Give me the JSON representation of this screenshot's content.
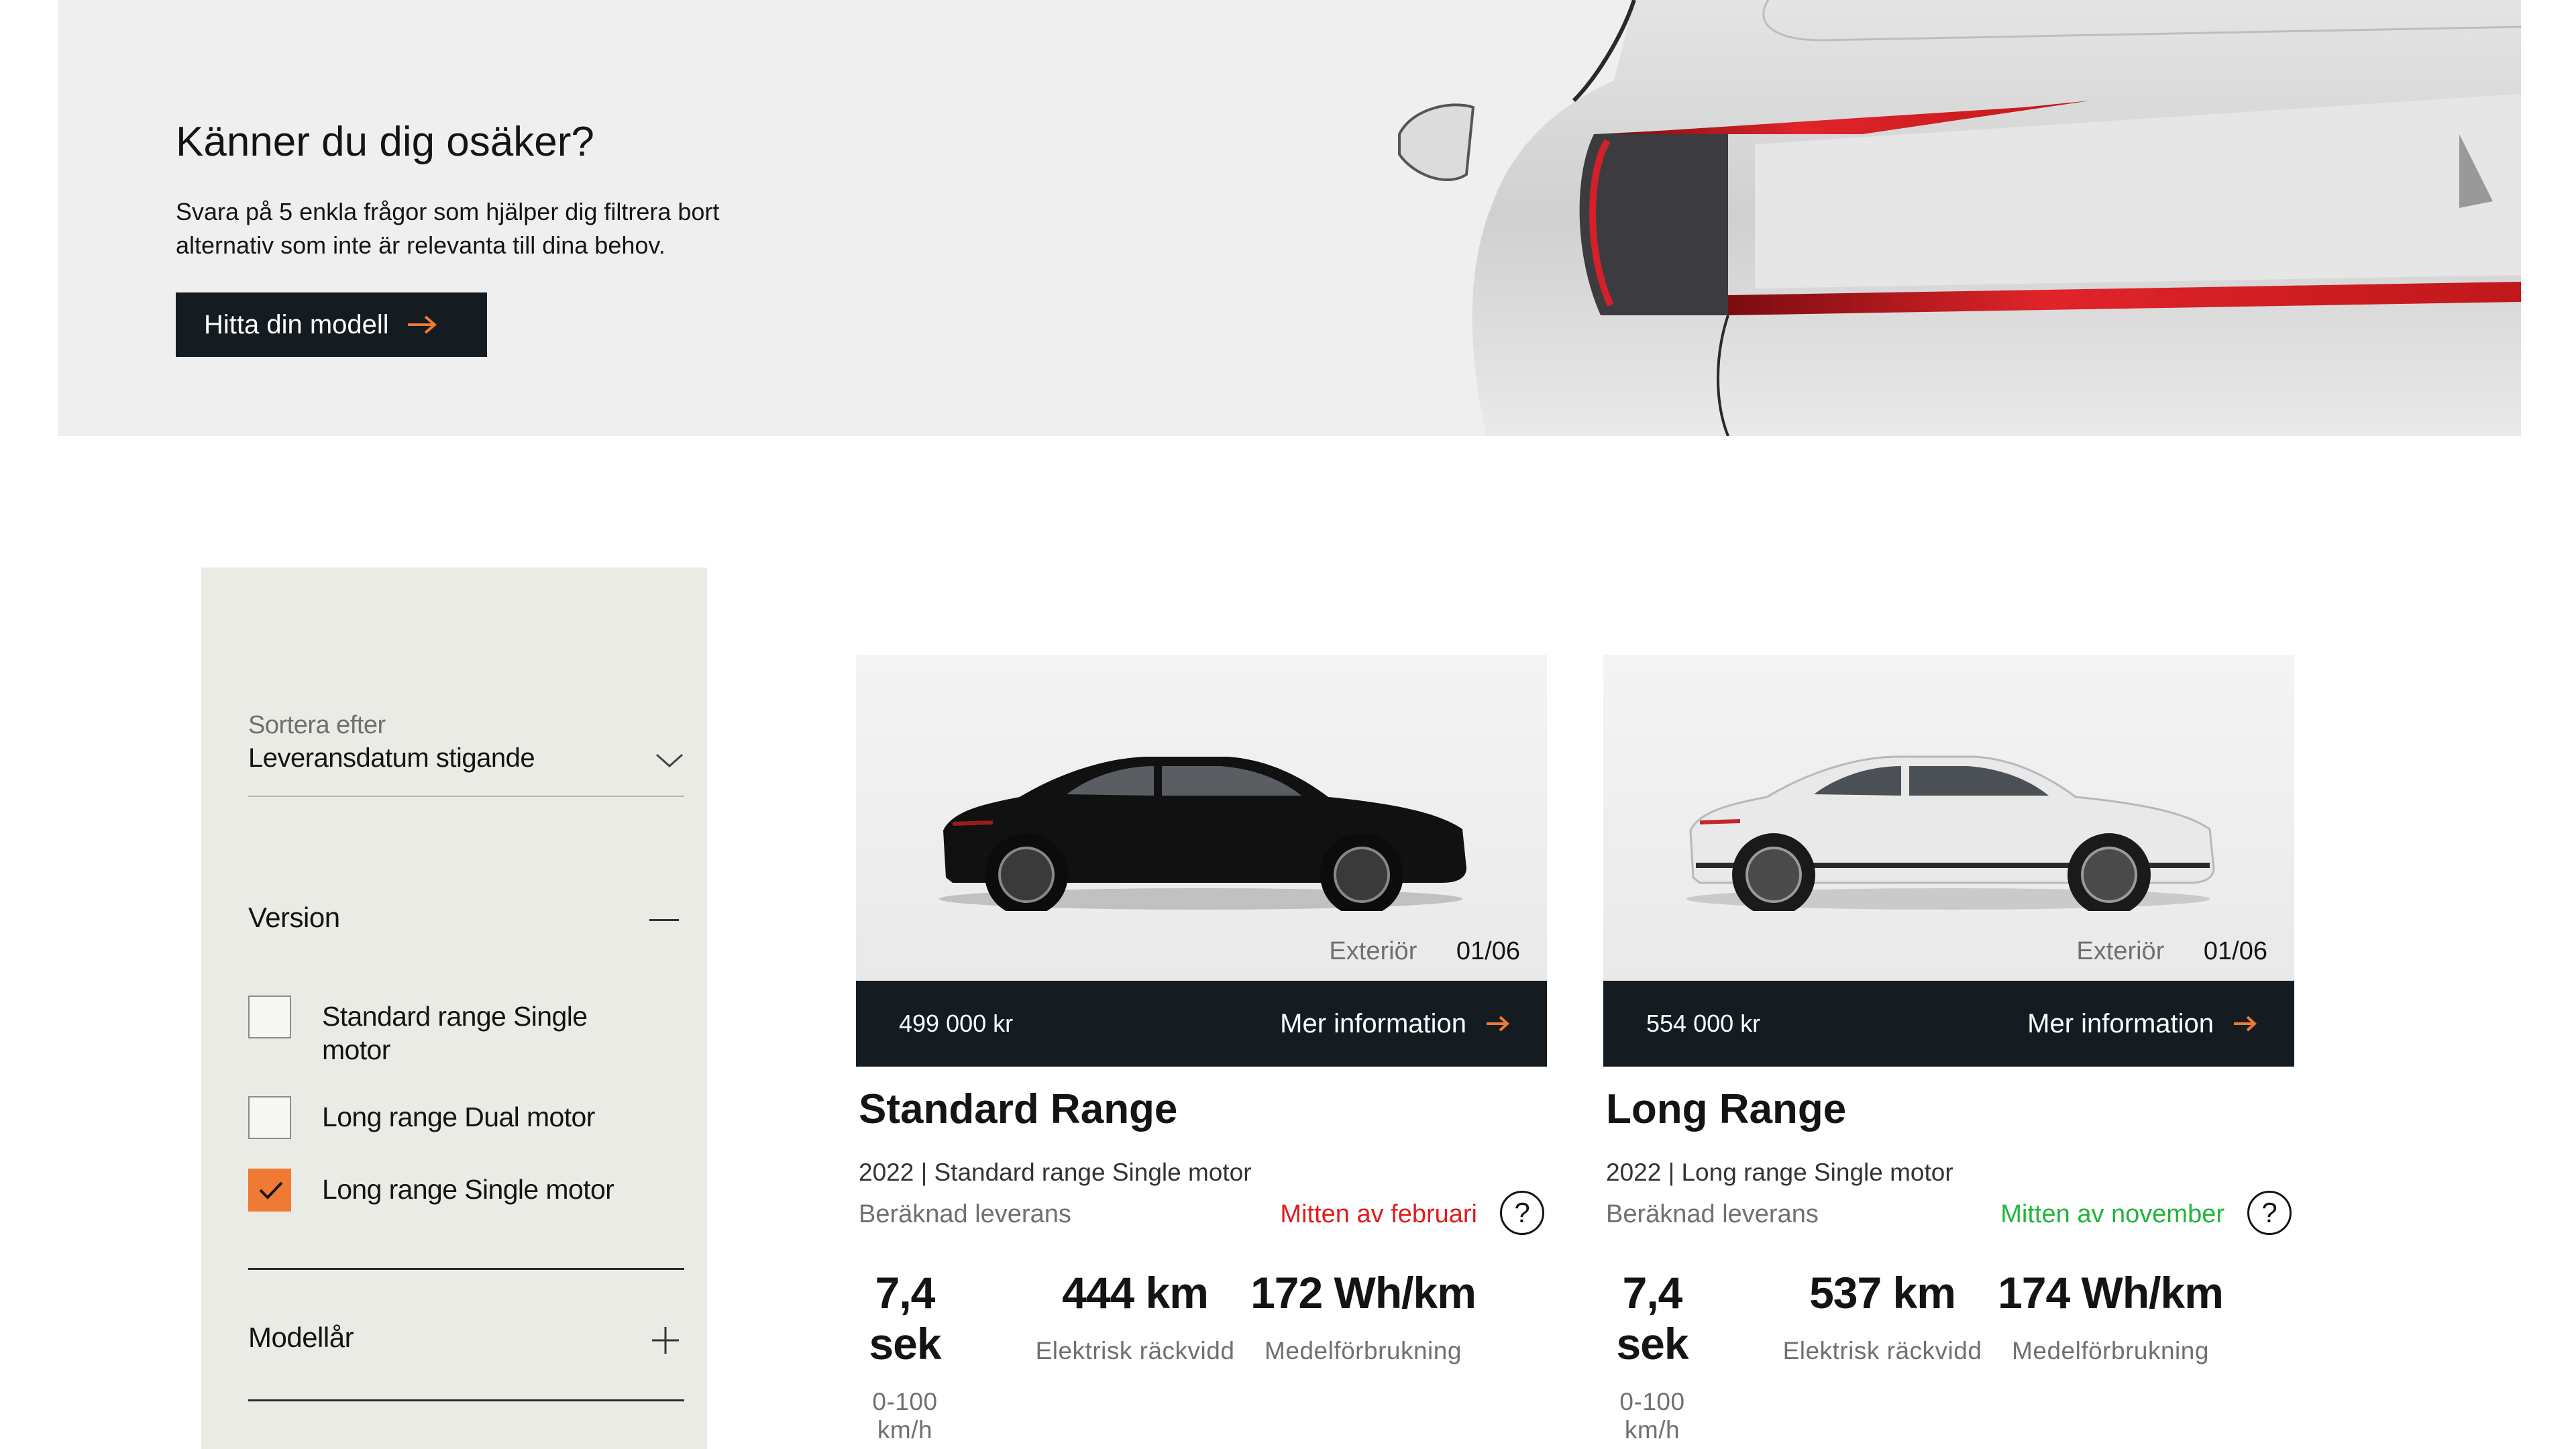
{
  "hero": {
    "title": "Känner du dig osäker?",
    "subtitle": "Svara på 5 enkla frågor som hjälper dig filtrera bort alternativ som inte är relevanta till dina behov.",
    "button_label": "Hitta din modell"
  },
  "filters": {
    "sort_label": "Sortera efter",
    "sort_value": "Leveransdatum stigande",
    "version_title": "Version",
    "options": [
      {
        "label": "Standard range Single motor",
        "checked": false
      },
      {
        "label": "Long range Dual motor",
        "checked": false
      },
      {
        "label": "Long range Single motor",
        "checked": true
      }
    ],
    "model_year_title": "Modellår"
  },
  "cards": [
    {
      "image_label": "Exteriör",
      "image_counter": "01/06",
      "price": "499 000 kr",
      "more_label": "Mer information",
      "title": "Standard Range",
      "subtitle": "2022 | Standard range Single motor",
      "delivery_label": "Beräknad leverans",
      "delivery_date": "Mitten av februari",
      "help": "?",
      "car_color": "black",
      "specs": [
        {
          "value": "7,4 sek",
          "label": "0-100 km/h"
        },
        {
          "value": "444 km",
          "label": "Elektrisk räckvidd"
        },
        {
          "value": "172 Wh/km",
          "label": "Medelförbrukning"
        }
      ]
    },
    {
      "image_label": "Exteriör",
      "image_counter": "01/06",
      "price": "554 000 kr",
      "more_label": "Mer information",
      "title": "Long Range",
      "subtitle": "2022 | Long range Single motor",
      "delivery_label": "Beräknad leverans",
      "delivery_date": "Mitten av november",
      "help": "?",
      "car_color": "white",
      "specs": [
        {
          "value": "7,4 sek",
          "label": "0-100 km/h"
        },
        {
          "value": "537 km",
          "label": "Elektrisk räckvidd"
        },
        {
          "value": "174 Wh/km",
          "label": "Medelförbrukning"
        }
      ]
    }
  ],
  "colors": {
    "accent": "#f07a34",
    "dark_bar": "#141c21",
    "panel_bg": "#ebebe6",
    "delivery_late": "#e01c1c",
    "delivery_early": "#22b43c"
  }
}
